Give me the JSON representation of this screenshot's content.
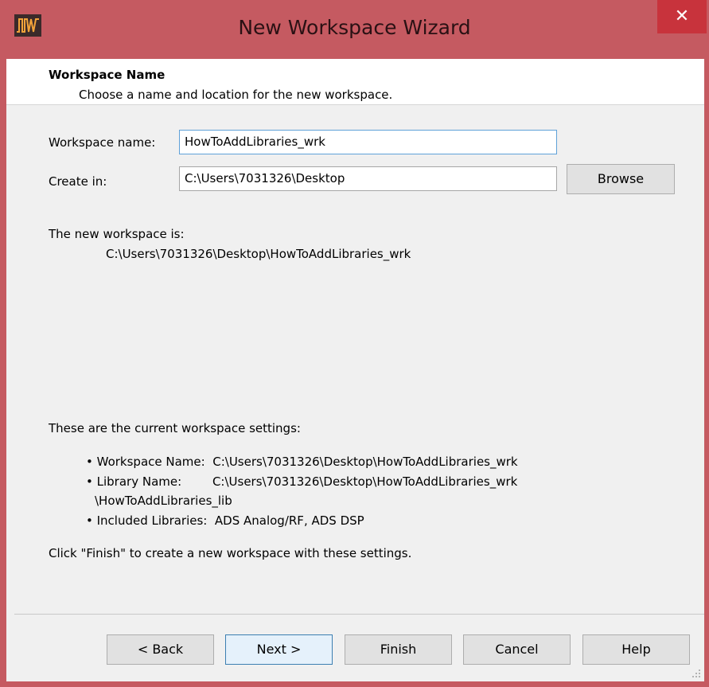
{
  "window": {
    "title": "New Workspace Wizard",
    "close_label": "✕",
    "app_icon": "ads-logo-icon"
  },
  "header": {
    "title": "Workspace Name",
    "subtitle": "Choose a name and location for the new workspace."
  },
  "form": {
    "name_label": "Workspace name:",
    "name_value": "HowToAddLibraries_wrk",
    "location_label": "Create in:",
    "location_value": "C:\\Users\\7031326\\Desktop",
    "browse_label": "Browse"
  },
  "summary": {
    "path_heading": "The new workspace is:",
    "path_value": "C:\\Users\\7031326\\Desktop\\HowToAddLibraries_wrk",
    "settings_heading": "These are the current workspace settings:",
    "settings": [
      {
        "label": "Workspace Name:",
        "value": "C:\\Users\\7031326\\Desktop\\HowToAddLibraries_wrk",
        "cont": ""
      },
      {
        "label": "Library Name:",
        "value": "C:\\Users\\7031326\\Desktop\\HowToAddLibraries_wrk",
        "cont": "\\HowToAddLibraries_lib"
      },
      {
        "label": "Included Libraries:",
        "value": "ADS Analog/RF, ADS DSP",
        "cont": ""
      }
    ],
    "finish_note": "Click \"Finish\" to create a new workspace with these settings."
  },
  "buttons": {
    "back": "< Back",
    "next": "Next >",
    "finish": "Finish",
    "cancel": "Cancel",
    "help": "Help"
  }
}
